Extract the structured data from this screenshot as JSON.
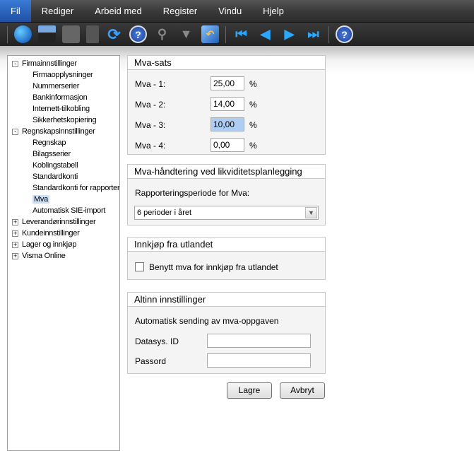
{
  "menu": [
    "Fil",
    "Rediger",
    "Arbeid med",
    "Register",
    "Vindu",
    "Hjelp"
  ],
  "tree": [
    {
      "label": "Firmainnstillinger",
      "level": 0,
      "exp": "-"
    },
    {
      "label": "Firmaopplysninger",
      "level": 1
    },
    {
      "label": "Nummerserier",
      "level": 1
    },
    {
      "label": "Bankinformasjon",
      "level": 1
    },
    {
      "label": "Internett-tilkobling",
      "level": 1
    },
    {
      "label": "Sikkerhetskopiering",
      "level": 1
    },
    {
      "label": "Regnskapsinnstillinger",
      "level": 0,
      "exp": "-"
    },
    {
      "label": "Regnskap",
      "level": 1
    },
    {
      "label": "Bilagsserier",
      "level": 1
    },
    {
      "label": "Koblingstabell",
      "level": 1
    },
    {
      "label": "Standardkonti",
      "level": 1
    },
    {
      "label": "Standardkonti for rapporter",
      "level": 1
    },
    {
      "label": "Mva",
      "level": 1,
      "selected": true
    },
    {
      "label": "Automatisk SIE-import",
      "level": 1
    },
    {
      "label": "Leverandørinnstillinger",
      "level": 0,
      "exp": "+"
    },
    {
      "label": "Kundeinnstillinger",
      "level": 0,
      "exp": "+"
    },
    {
      "label": "Lager og innkjøp",
      "level": 0,
      "exp": "+"
    },
    {
      "label": "Visma Online",
      "level": 0,
      "exp": "+"
    }
  ],
  "mva_sats": {
    "title": "Mva-sats",
    "rows": [
      {
        "label": "Mva - 1:",
        "value": "25,00",
        "unit": "%"
      },
      {
        "label": "Mva - 2:",
        "value": "14,00",
        "unit": "%"
      },
      {
        "label": "Mva - 3:",
        "value": "10,00",
        "unit": "%"
      },
      {
        "label": "Mva - 4:",
        "value": "0,00",
        "unit": "%"
      }
    ]
  },
  "likviditet": {
    "title": "Mva-håndtering ved likviditetsplanlegging",
    "label": "Rapporteringsperiode for Mva:",
    "selected": "6 perioder i året"
  },
  "utland": {
    "title": "Innkjøp fra utlandet",
    "checkbox": "Benytt mva for innkjøp fra utlandet",
    "checked": false
  },
  "altinn": {
    "title": "Altinn innstillinger",
    "info": "Automatisk sending av mva-oppgaven",
    "datasys_label": "Datasys. ID",
    "datasys_value": "",
    "passord_label": "Passord",
    "passord_value": ""
  },
  "buttons": {
    "save": "Lagre",
    "cancel": "Avbryt"
  }
}
